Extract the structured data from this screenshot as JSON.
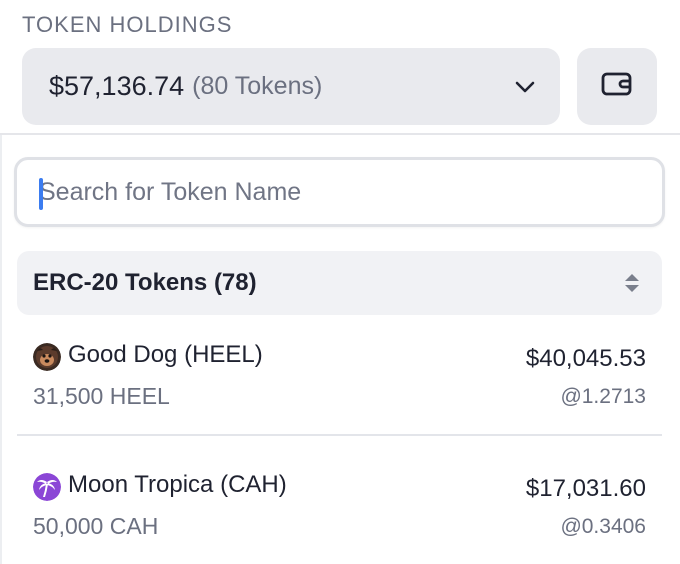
{
  "header": {
    "title": "TOKEN HOLDINGS"
  },
  "summary": {
    "total_value": "$57,136.74",
    "token_count": "(80 Tokens)",
    "chevron_icon": "chevron-down-icon",
    "wallet_icon": "wallet-icon"
  },
  "search": {
    "placeholder": "Search for Token Name",
    "value": ""
  },
  "group": {
    "label": "ERC-20 Tokens (78)",
    "sort_icon": "sort-updown-icon"
  },
  "tokens": [
    {
      "name": "Good Dog (HEEL)",
      "quantity": "31,500 HEEL",
      "value": "$40,045.53",
      "price": "@1.2713",
      "icon": "good-dog-token-icon"
    },
    {
      "name": "Moon Tropica (CAH)",
      "quantity": "50,000 CAH",
      "value": "$17,031.60",
      "price": "@0.3406",
      "icon": "moon-tropica-token-icon"
    }
  ],
  "colors": {
    "accent_caret": "#3b7cf0",
    "surface": "#e9eaee",
    "muted_text": "#6b7080",
    "moon_tropica": "#8b46d6"
  }
}
